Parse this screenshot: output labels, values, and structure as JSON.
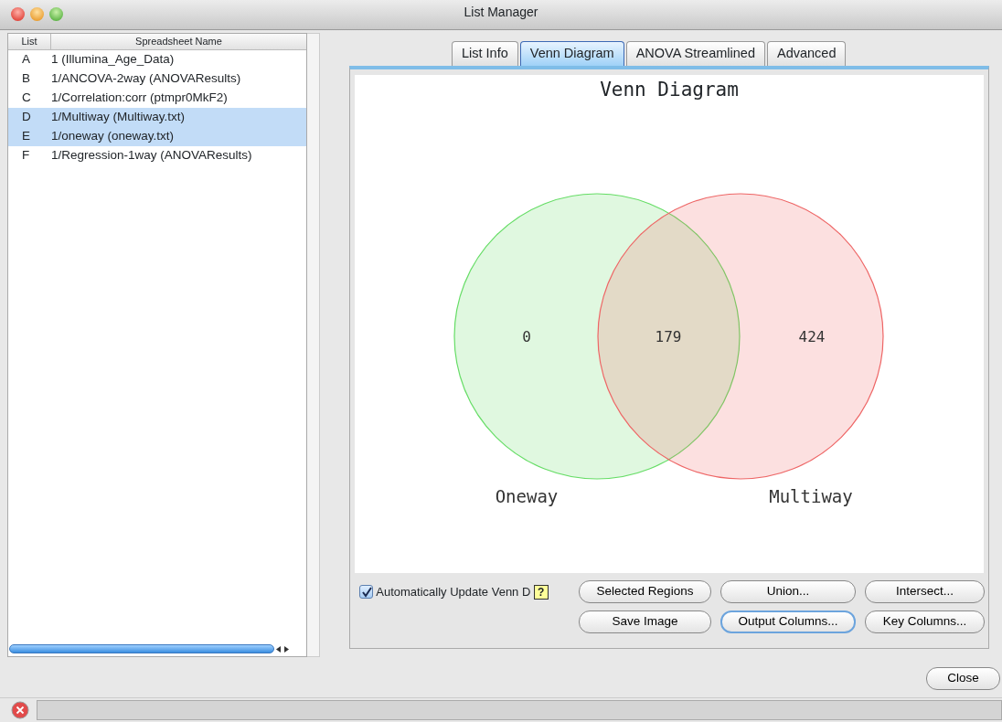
{
  "window": {
    "title": "List Manager"
  },
  "lists": {
    "columns": [
      "List",
      "Spreadsheet Name"
    ],
    "rows": [
      {
        "list": "A",
        "name": "1 (Illumina_Age_Data)",
        "selected": false
      },
      {
        "list": "B",
        "name": "1/ANCOVA-2way (ANOVAResults)",
        "selected": false
      },
      {
        "list": "C",
        "name": "1/Correlation:corr (ptmpr0MkF2)",
        "selected": false
      },
      {
        "list": "D",
        "name": "1/Multiway (Multiway.txt)",
        "selected": true
      },
      {
        "list": "E",
        "name": "1/oneway (oneway.txt)",
        "selected": true
      },
      {
        "list": "F",
        "name": "1/Regression-1way (ANOVAResults)",
        "selected": false
      }
    ]
  },
  "tabs": [
    {
      "label": "List Info",
      "selected": false
    },
    {
      "label": "Venn Diagram",
      "selected": true
    },
    {
      "label": "ANOVA Streamlined",
      "selected": false
    },
    {
      "label": "Advanced",
      "selected": false
    }
  ],
  "venn": {
    "title": "Venn Diagram",
    "sets": [
      {
        "label": "Oneway",
        "color": "#66dd66"
      },
      {
        "label": "Multiway",
        "color": "#ee6666"
      }
    ],
    "counts": [
      "0",
      "179",
      "424"
    ]
  },
  "auto_update": {
    "label": "Automatically Update Venn D",
    "checked": true,
    "help": "?"
  },
  "buttons": [
    {
      "label": "Selected Regions",
      "focused": false
    },
    {
      "label": "Union...",
      "focused": false
    },
    {
      "label": "Intersect...",
      "focused": false
    },
    {
      "label": "Save Image",
      "focused": false
    },
    {
      "label": "Output Columns...",
      "focused": true
    },
    {
      "label": "Key Columns...",
      "focused": false
    }
  ],
  "close_button": "Close"
}
